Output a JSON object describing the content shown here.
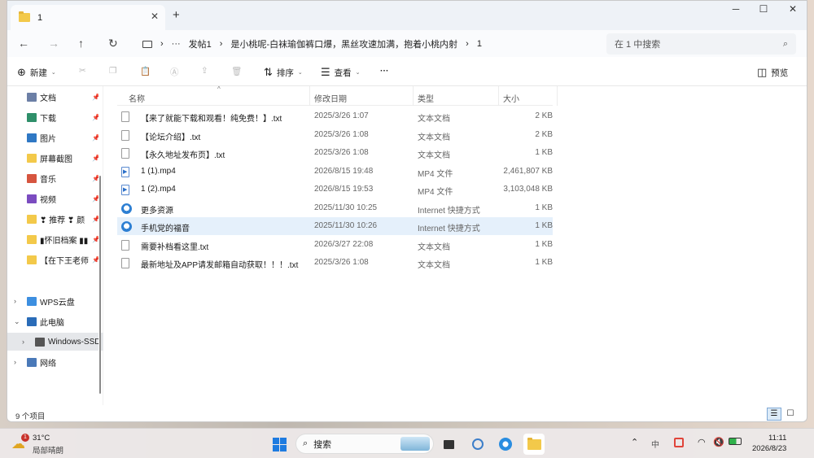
{
  "window": {
    "tab_title": "1",
    "new_tab_icon": "plus-icon",
    "minimize": "─",
    "maximize": "☐",
    "close": "✕"
  },
  "nav": {
    "breadcrumb": [
      "发帖1",
      "是小桃呢-白袜瑜伽裤口爆，黑丝攻速加满，抱着小桃内射",
      "1"
    ],
    "search_placeholder": "在 1 中搜索"
  },
  "toolbar": {
    "new_label": "新建",
    "sort_label": "排序",
    "view_label": "查看",
    "more_label": "···",
    "preview_label": "预览"
  },
  "sidebar": {
    "quick": [
      {
        "label": "文档",
        "color": "#6c7fa6"
      },
      {
        "label": "下载",
        "color": "#2f8f6a"
      },
      {
        "label": "图片",
        "color": "#2f78c4"
      },
      {
        "label": "屏幕截图",
        "color": "#f3c94a"
      },
      {
        "label": "音乐",
        "color": "#d6553f"
      },
      {
        "label": "视频",
        "color": "#7b4cc0"
      },
      {
        "label": "❣ 推荐 ❣ 颜",
        "color": "#f3c94a"
      },
      {
        "label": "▮怀旧档案 ▮▮",
        "color": "#f3c94a"
      },
      {
        "label": "【在下王老师",
        "color": "#f3c94a"
      }
    ],
    "tree": [
      {
        "label": "WPS云盘",
        "chevron": "›"
      },
      {
        "label": "此电脑",
        "chevron": "⌄"
      },
      {
        "label": "Windows-SSD",
        "chevron": "›"
      },
      {
        "label": "网络",
        "chevron": "›"
      }
    ]
  },
  "columns": [
    "名称",
    "修改日期",
    "类型",
    "大小"
  ],
  "files": [
    {
      "name": "【来了就能下载和观看！纯免费！】.txt",
      "date": "2025/3/26 1:07",
      "type": "文本文档",
      "size": "2 KB",
      "kind": "txt"
    },
    {
      "name": "【论坛介绍】.txt",
      "date": "2025/3/26 1:08",
      "type": "文本文档",
      "size": "2 KB",
      "kind": "txt"
    },
    {
      "name": "【永久地址发布页】.txt",
      "date": "2025/3/26 1:08",
      "type": "文本文档",
      "size": "1 KB",
      "kind": "txt"
    },
    {
      "name": "1 (1).mp4",
      "date": "2026/8/15 19:48",
      "type": "MP4 文件",
      "size": "2,461,807 KB",
      "kind": "mp4"
    },
    {
      "name": "1 (2).mp4",
      "date": "2026/8/15 19:53",
      "type": "MP4 文件",
      "size": "3,103,048 KB",
      "kind": "mp4"
    },
    {
      "name": "更多资源",
      "date": "2025/11/30 10:25",
      "type": "Internet 快捷方式",
      "size": "1 KB",
      "kind": "url"
    },
    {
      "name": "手机党的福音",
      "date": "2025/11/30 10:26",
      "type": "Internet 快捷方式",
      "size": "1 KB",
      "kind": "url"
    },
    {
      "name": "需要补档看这里.txt",
      "date": "2026/3/27 22:08",
      "type": "文本文档",
      "size": "1 KB",
      "kind": "txt"
    },
    {
      "name": "最新地址及APP请发邮箱自动获取！！！.txt",
      "date": "2025/3/26 1:08",
      "type": "文本文档",
      "size": "1 KB",
      "kind": "txt"
    }
  ],
  "status": {
    "count": "9 个项目"
  },
  "taskbar": {
    "weather_temp": "31°C",
    "weather_desc": "局部晴朗",
    "weather_badge": "1",
    "search_label": "搜索",
    "time": "11:11",
    "date": "2026/8/23",
    "ime": "中"
  }
}
